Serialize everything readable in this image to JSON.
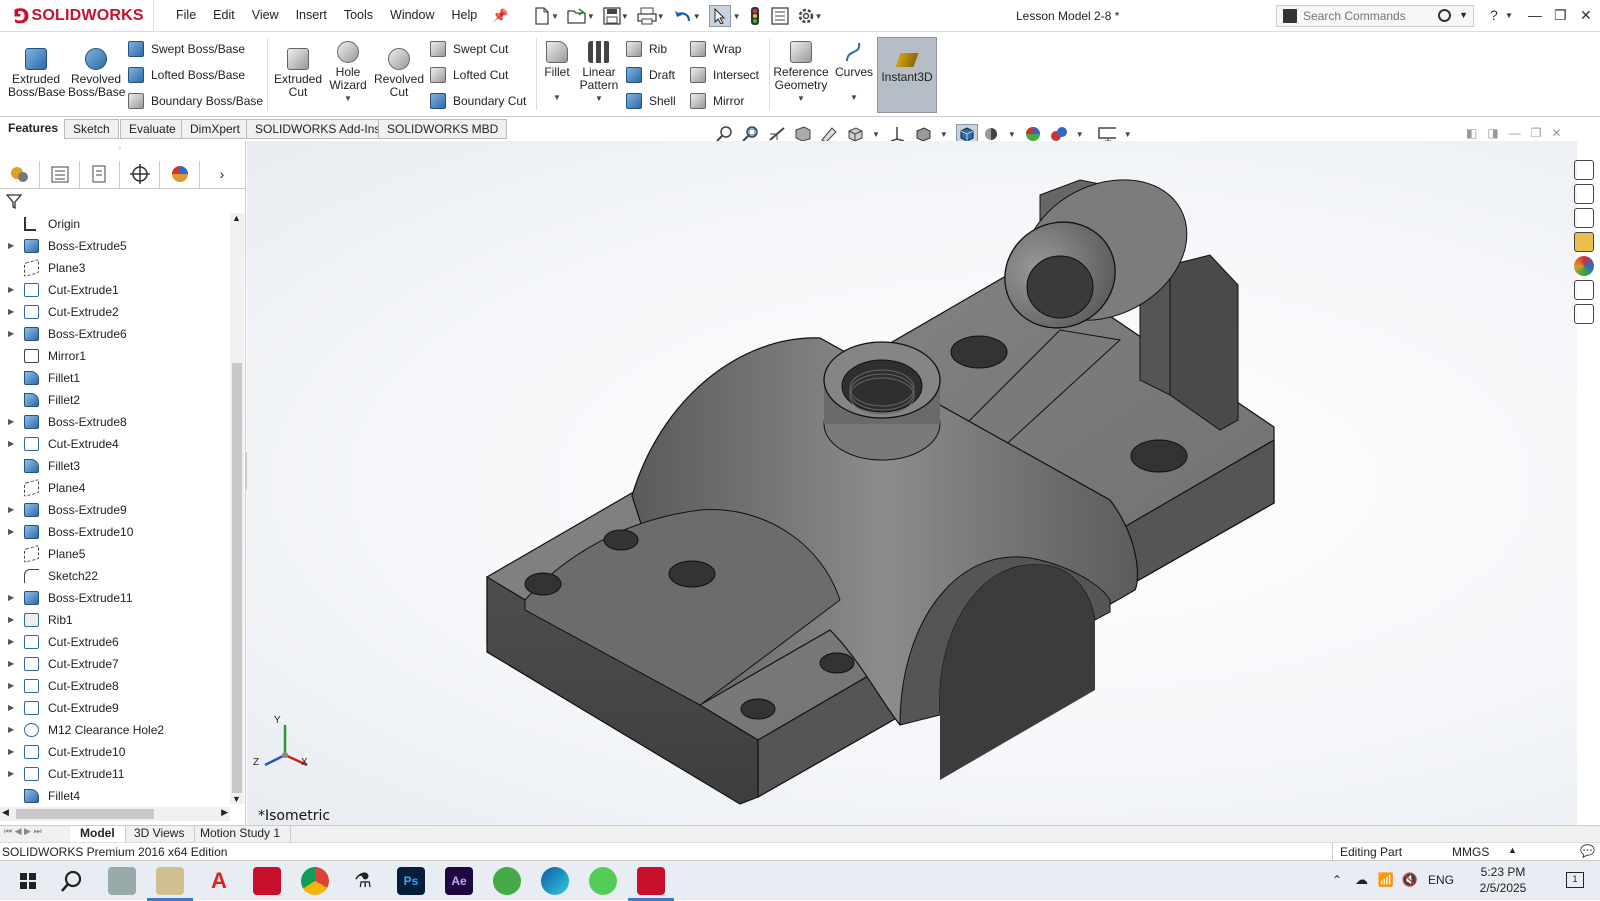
{
  "app": {
    "logo_text": "SOLIDWORKS",
    "document_title": "Lesson Model 2-8 *",
    "search_placeholder": "Search Commands",
    "help_label": "?"
  },
  "menu": [
    "File",
    "Edit",
    "View",
    "Insert",
    "Tools",
    "Window",
    "Help"
  ],
  "ribbon": {
    "extruded_boss": "Extruded\nBoss/Base",
    "revolved_boss": "Revolved\nBoss/Base",
    "swept_boss": "Swept Boss/Base",
    "lofted_boss": "Lofted Boss/Base",
    "boundary_boss": "Boundary Boss/Base",
    "extruded_cut": "Extruded\nCut",
    "hole_wizard": "Hole\nWizard",
    "revolved_cut": "Revolved\nCut",
    "swept_cut": "Swept Cut",
    "lofted_cut": "Lofted Cut",
    "boundary_cut": "Boundary Cut",
    "fillet": "Fillet",
    "linear_pattern": "Linear\nPattern",
    "rib": "Rib",
    "draft": "Draft",
    "shell": "Shell",
    "wrap": "Wrap",
    "intersect": "Intersect",
    "mirror": "Mirror",
    "reference_geometry": "Reference\nGeometry",
    "curves": "Curves",
    "instant3d": "Instant3D"
  },
  "command_tabs": [
    "Features",
    "Sketch",
    "Evaluate",
    "DimXpert",
    "SOLIDWORKS Add-Ins",
    "SOLIDWORKS MBD"
  ],
  "feature_tree": [
    {
      "label": "Origin",
      "type": "origin",
      "expandable": false
    },
    {
      "label": "Boss-Extrude5",
      "type": "boss",
      "expandable": true
    },
    {
      "label": "Plane3",
      "type": "plane",
      "expandable": false
    },
    {
      "label": "Cut-Extrude1",
      "type": "cut",
      "expandable": true
    },
    {
      "label": "Cut-Extrude2",
      "type": "cut",
      "expandable": true
    },
    {
      "label": "Boss-Extrude6",
      "type": "boss",
      "expandable": true
    },
    {
      "label": "Mirror1",
      "type": "mirror",
      "expandable": false
    },
    {
      "label": "Fillet1",
      "type": "fillet",
      "expandable": false
    },
    {
      "label": "Fillet2",
      "type": "fillet",
      "expandable": false
    },
    {
      "label": "Boss-Extrude8",
      "type": "boss",
      "expandable": true
    },
    {
      "label": "Cut-Extrude4",
      "type": "cut",
      "expandable": true
    },
    {
      "label": "Fillet3",
      "type": "fillet",
      "expandable": false
    },
    {
      "label": "Plane4",
      "type": "plane",
      "expandable": false
    },
    {
      "label": "Boss-Extrude9",
      "type": "boss",
      "expandable": true
    },
    {
      "label": "Boss-Extrude10",
      "type": "boss",
      "expandable": true
    },
    {
      "label": "Plane5",
      "type": "plane",
      "expandable": false
    },
    {
      "label": "Sketch22",
      "type": "sketch",
      "expandable": false
    },
    {
      "label": "Boss-Extrude11",
      "type": "boss",
      "expandable": true
    },
    {
      "label": "Rib1",
      "type": "rib",
      "expandable": true
    },
    {
      "label": "Cut-Extrude6",
      "type": "cut",
      "expandable": true
    },
    {
      "label": "Cut-Extrude7",
      "type": "cut",
      "expandable": true
    },
    {
      "label": "Cut-Extrude8",
      "type": "cut",
      "expandable": true
    },
    {
      "label": "Cut-Extrude9",
      "type": "cut",
      "expandable": true
    },
    {
      "label": "M12 Clearance Hole2",
      "type": "hole",
      "expandable": true
    },
    {
      "label": "Cut-Extrude10",
      "type": "cut",
      "expandable": true
    },
    {
      "label": "Cut-Extrude11",
      "type": "cut",
      "expandable": true
    },
    {
      "label": "Fillet4",
      "type": "fillet",
      "expandable": false
    }
  ],
  "viewport": {
    "view_orientation": "*Isometric",
    "triad": {
      "x": "X",
      "y": "Y",
      "z": "Z"
    }
  },
  "bottom_tabs": [
    "Model",
    "3D Views",
    "Motion Study 1"
  ],
  "status": {
    "edition": "SOLIDWORKS Premium 2016 x64 Edition",
    "mode": "Editing Part",
    "units": "MMGS"
  },
  "taskbar": {
    "language": "ENG",
    "time": "5:23 PM",
    "date": "2/5/2025",
    "notifications": "1"
  },
  "colors": {
    "brand_red": "#c8102e",
    "accent_blue": "#2e6aa8",
    "part_grey": "#6e6e6e"
  }
}
